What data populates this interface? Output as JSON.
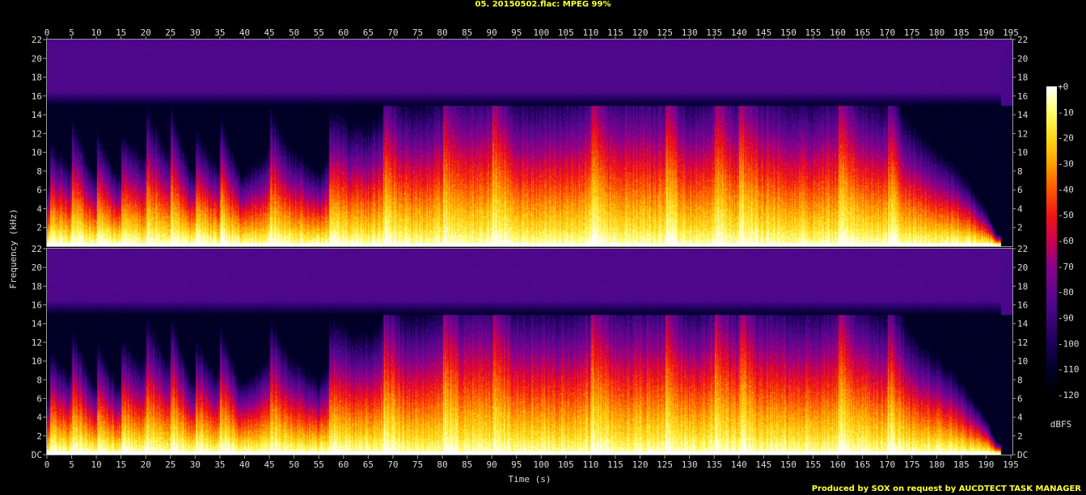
{
  "title": "05. 20150502.flac: MPEG 99%",
  "credit": "Produced by SOX on request by AUCDTECT TASK MANAGER",
  "chart_data": {
    "type": "heatmap",
    "title": "05. 20150502.flac: MPEG 99%",
    "xlabel": "Time (s)",
    "ylabel": "Frequency (kHz)",
    "channels": 2,
    "xlim": [
      0,
      195
    ],
    "ylim": [
      0,
      22
    ],
    "x_ticks": [
      "0",
      "5",
      "10",
      "15",
      "20",
      "25",
      "30",
      "35",
      "40",
      "45",
      "50",
      "55",
      "60",
      "65",
      "70",
      "75",
      "80",
      "85",
      "90",
      "95",
      "100",
      "105",
      "110",
      "115",
      "120",
      "125",
      "130",
      "135",
      "140",
      "145",
      "150",
      "155",
      "160",
      "165",
      "170",
      "175",
      "180",
      "185",
      "190",
      "195"
    ],
    "y_ticks_top": [
      "2",
      "4",
      "6",
      "8",
      "10",
      "12",
      "14",
      "16",
      "18",
      "20",
      "22"
    ],
    "y_ticks_bottom": [
      "DC",
      "2",
      "4",
      "6",
      "8",
      "10",
      "12",
      "14",
      "16",
      "18",
      "20",
      "22"
    ],
    "colorbar": {
      "label": "dBFS",
      "ticks": [
        "+0",
        "-10",
        "-20",
        "-30",
        "-40",
        "-50",
        "-60",
        "-70",
        "-80",
        "-90",
        "-100",
        "-110",
        "-120"
      ],
      "range": [
        -120,
        0
      ]
    },
    "lowpass_cutoff_khz": 15.5,
    "audio_end_s": 193,
    "energy_extent_khz": {
      "times": [
        0,
        5,
        10,
        15,
        20,
        25,
        30,
        35,
        40,
        45,
        50,
        55,
        60,
        65,
        70,
        75,
        80,
        85,
        90,
        95,
        100,
        105,
        110,
        115,
        120,
        125,
        130,
        135,
        140,
        145,
        150,
        155,
        160,
        165,
        170,
        175,
        180,
        185,
        190,
        193
      ],
      "values": [
        5,
        7,
        6,
        6,
        8,
        8,
        6,
        7,
        6,
        8,
        8,
        6,
        10,
        10,
        12,
        12,
        13,
        14,
        14,
        13,
        13,
        13,
        14,
        14,
        14,
        14,
        13,
        14,
        14,
        14,
        13,
        13,
        14,
        13,
        12,
        10,
        8,
        6,
        3,
        0
      ]
    },
    "onsets_s": [
      0.5,
      5,
      10,
      15,
      20,
      25,
      30,
      35,
      45,
      57,
      68,
      80,
      90,
      110,
      125,
      135,
      140,
      160,
      170
    ]
  }
}
